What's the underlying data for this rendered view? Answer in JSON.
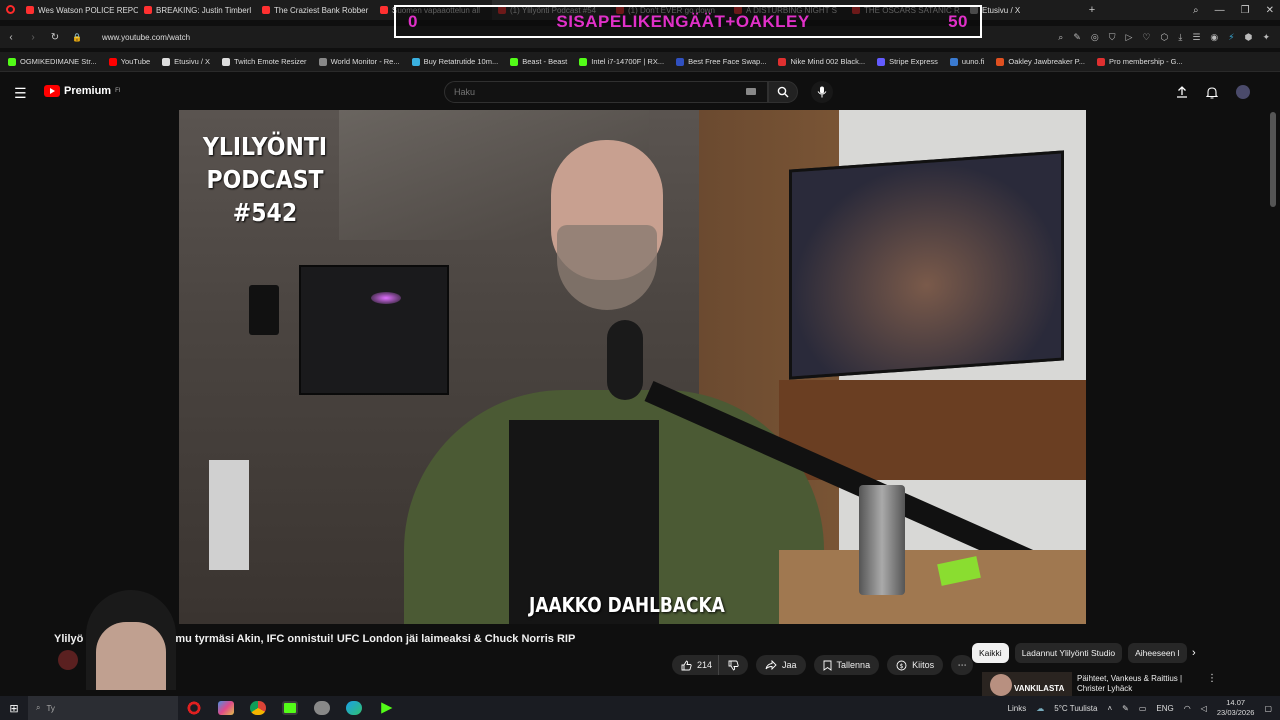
{
  "browser": {
    "tabs": [
      {
        "label": "Wes Watson POLICE REPO",
        "color": "#ff3030"
      },
      {
        "label": "BREAKING: Justin Timberl",
        "color": "#ff3030"
      },
      {
        "label": "The Craziest Bank Robber",
        "color": "#ff3030"
      },
      {
        "label": "Suomen vapaaottelun all",
        "color": "#ff3030"
      },
      {
        "label": "(1) Ylilyönti Podcast #54",
        "color": "#ff3030"
      },
      {
        "label": "(1) Don't EVER go down",
        "color": "#ff3030"
      },
      {
        "label": "A DISTURBING NIGHT S",
        "color": "#ff3030"
      },
      {
        "label": "THE OSCARS SATANIC R",
        "color": "#ff3030"
      },
      {
        "label": "Etusivu / X",
        "color": "#aaaaaa"
      }
    ],
    "new_tab": "+",
    "url": "www.youtube.com/watch",
    "bookmarks": [
      {
        "label": "OGMIKEDIMANE Str...",
        "color": "#53fc18"
      },
      {
        "label": "YouTube",
        "color": "#ff0000"
      },
      {
        "label": "Etusivu / X",
        "color": "#dddddd"
      },
      {
        "label": "Twitch Emote Resizer",
        "color": "#dddddd"
      },
      {
        "label": "World Monitor - Re...",
        "color": "#888888"
      },
      {
        "label": "Buy Retatrutide 10m...",
        "color": "#3ab0e0"
      },
      {
        "label": "Beast - Beast",
        "color": "#53fc18"
      },
      {
        "label": "Intel i7-14700F | RX...",
        "color": "#53fc18"
      },
      {
        "label": "Best Free Face Swap...",
        "color": "#3050c0"
      },
      {
        "label": "Nike Mind 002 Black...",
        "color": "#e03030"
      },
      {
        "label": "Stripe Express",
        "color": "#635bff"
      },
      {
        "label": "uuno.fi",
        "color": "#3a7ad0"
      },
      {
        "label": "Oakley Jawbreaker P...",
        "color": "#e05020"
      },
      {
        "label": "Pro membership - G...",
        "color": "#e03030"
      }
    ]
  },
  "overlay": {
    "left_score": "0",
    "text": "SISAPELIKENGÄÄT+OAKLEY",
    "right_score": "50"
  },
  "youtube": {
    "logo_text": "Premium",
    "logo_sup": "FI",
    "search_placeholder": "Haku"
  },
  "video": {
    "title_line1": "YLILYÖNTI",
    "title_line2": "PODCAST",
    "title_line3": "#542",
    "guest_name": "JAAKKO DAHLBACKA"
  },
  "meta": {
    "title_start": "Ylilyö",
    "title_rest": "mu tyrmäsi Akin, IFC onnistui! UFC London jäi laimeaksi & Chuck Norris RIP",
    "likes": "214",
    "share": "Jaa",
    "save": "Tallenna",
    "thanks": "Kiitos",
    "more": "⋯"
  },
  "chips": {
    "items": [
      "Kaikki",
      "Ladannut Ylilyönti Studio",
      "Aiheeseen l"
    ],
    "selected": 0
  },
  "recommended": {
    "title": "Päihteet, Vankeus & Raittius | Christer Lyhäck",
    "thumb_text": "VANKILASTA"
  },
  "taskbar": {
    "search_label": "Ty",
    "links": "Links",
    "weather": "5°C Tuulista",
    "lang": "ENG",
    "time": "14.07",
    "date": "23/03/2026"
  }
}
